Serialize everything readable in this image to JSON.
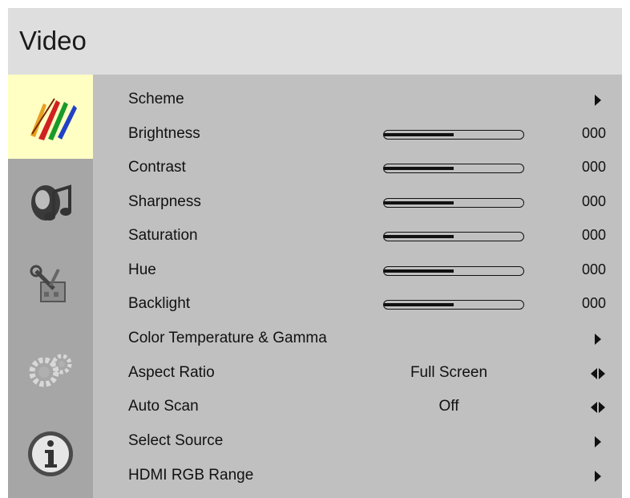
{
  "header": {
    "title": "Video"
  },
  "sidebar": {
    "items": [
      {
        "icon": "video-brushes-icon",
        "active": true
      },
      {
        "icon": "audio-note-icon",
        "active": false
      },
      {
        "icon": "setup-tools-icon",
        "active": false
      },
      {
        "icon": "settings-gears-icon",
        "active": false
      },
      {
        "icon": "info-icon",
        "active": false
      }
    ]
  },
  "menu": {
    "items": [
      {
        "label": "Scheme",
        "type": "submenu"
      },
      {
        "label": "Brightness",
        "type": "slider",
        "level": 0.5,
        "value": "000"
      },
      {
        "label": "Contrast",
        "type": "slider",
        "level": 0.5,
        "value": "000"
      },
      {
        "label": "Sharpness",
        "type": "slider",
        "level": 0.5,
        "value": "000"
      },
      {
        "label": "Saturation",
        "type": "slider",
        "level": 0.5,
        "value": "000"
      },
      {
        "label": "Hue",
        "type": "slider",
        "level": 0.5,
        "value": "000"
      },
      {
        "label": "Backlight",
        "type": "slider",
        "level": 0.5,
        "value": "000"
      },
      {
        "label": "Color Temperature & Gamma",
        "type": "submenu"
      },
      {
        "label": "Aspect Ratio",
        "type": "option",
        "value": "Full Screen"
      },
      {
        "label": "Auto Scan",
        "type": "option",
        "value": "Off"
      },
      {
        "label": "Select Source",
        "type": "submenu"
      },
      {
        "label": "HDMI RGB Range",
        "type": "submenu"
      }
    ]
  },
  "colors": {
    "title_bar": "#dedede",
    "sidebar": "#a6a6a6",
    "sidebar_active": "#ffffc4",
    "panel": "#c0c0c0",
    "text": "#111111"
  }
}
